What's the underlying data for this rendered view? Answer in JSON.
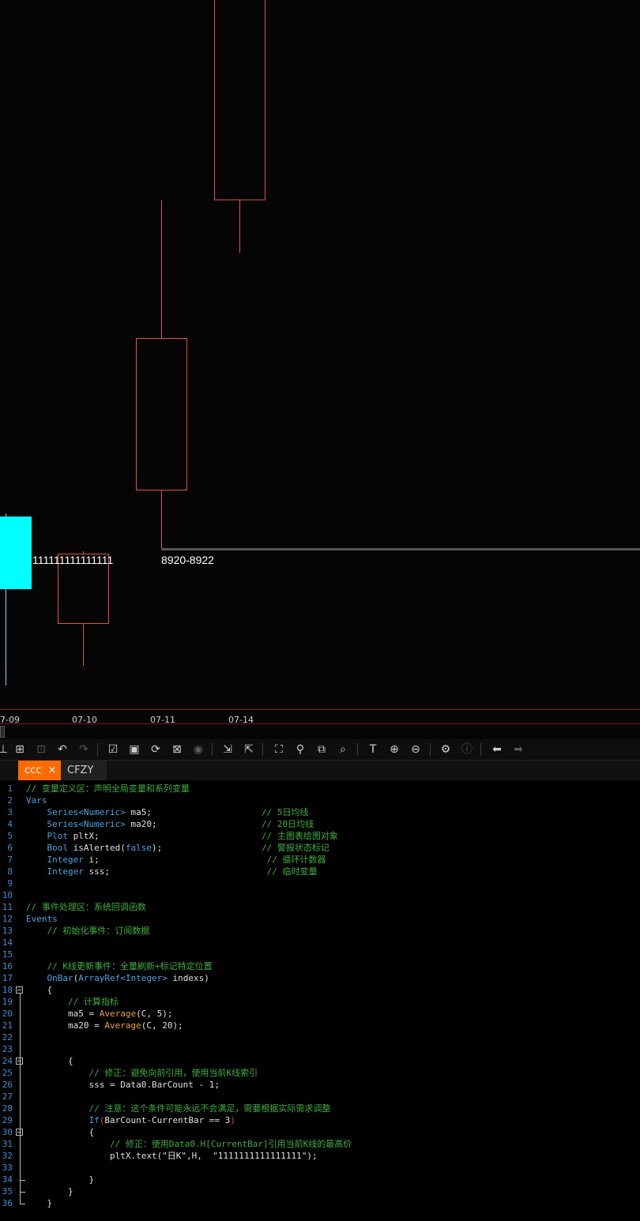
{
  "chart": {
    "annotations": {
      "marker_text": "111111111111111",
      "price_range": "8920-8922"
    },
    "date_labels": [
      "7-09",
      "07-10",
      "07-11",
      "07-14"
    ],
    "colors": {
      "candle_outline": "#e05050",
      "marker_box": "#00ffff",
      "background": "#050505",
      "axis_border": "#8a0f14",
      "price_line": "#555555"
    }
  },
  "toolbar": {
    "icons": [
      "add-icon",
      "new-file-icon",
      "template-icon",
      "undo-icon",
      "redo-icon",
      "check-icon",
      "save-icon",
      "refresh-icon",
      "compile-icon",
      "stop-icon",
      "import-icon",
      "export-icon",
      "fullscreen-icon",
      "search-icon",
      "copy-icon",
      "find-replace-icon",
      "text-icon",
      "zoom-in-icon",
      "zoom-out-icon",
      "settings-icon",
      "info-icon",
      "back-arrow-icon",
      "forward-arrow-icon"
    ]
  },
  "tabs": [
    {
      "label": "ccc",
      "close": "×"
    },
    {
      "label": "CFZY"
    }
  ],
  "editor": {
    "lines": [
      {
        "n": "1",
        "parts": [
          [
            "c-com",
            "// 变量定义区：声明全局变量和系列变量"
          ]
        ]
      },
      {
        "n": "2",
        "parts": [
          [
            "c-kw",
            "Vars"
          ]
        ]
      },
      {
        "n": "3",
        "parts": [
          [
            "c-txt",
            "    "
          ],
          [
            "c-kw",
            "Series<Numeric>"
          ],
          [
            "c-txt",
            " ma5;                     "
          ],
          [
            "c-com",
            "// 5日均线"
          ]
        ]
      },
      {
        "n": "4",
        "parts": [
          [
            "c-txt",
            "    "
          ],
          [
            "c-kw",
            "Series<Numeric>"
          ],
          [
            "c-txt",
            " ma20;                    "
          ],
          [
            "c-com",
            "// 20日均线"
          ]
        ]
      },
      {
        "n": "5",
        "parts": [
          [
            "c-txt",
            "    "
          ],
          [
            "c-kw",
            "Plot"
          ],
          [
            "c-txt",
            " pltX;                               "
          ],
          [
            "c-com",
            "// 主图表绘图对象"
          ]
        ]
      },
      {
        "n": "6",
        "parts": [
          [
            "c-txt",
            "    "
          ],
          [
            "c-kw",
            "Bool"
          ],
          [
            "c-txt",
            " isAlerted("
          ],
          [
            "c-kw",
            "false"
          ],
          [
            "c-txt",
            ");                   "
          ],
          [
            "c-com",
            "// 警报状态标记"
          ]
        ]
      },
      {
        "n": "7",
        "parts": [
          [
            "c-txt",
            "    "
          ],
          [
            "c-kw",
            "Integer"
          ],
          [
            "c-txt",
            " i;                                "
          ],
          [
            "c-com",
            "// 循环计数器"
          ]
        ]
      },
      {
        "n": "8",
        "parts": [
          [
            "c-txt",
            "    "
          ],
          [
            "c-kw",
            "Integer"
          ],
          [
            "c-txt",
            " sss;                              "
          ],
          [
            "c-com",
            "// 临时变量"
          ]
        ]
      },
      {
        "n": "9",
        "parts": []
      },
      {
        "n": "10",
        "parts": []
      },
      {
        "n": "11",
        "parts": [
          [
            "c-com",
            "// 事件处理区：系统回调函数"
          ]
        ]
      },
      {
        "n": "12",
        "parts": [
          [
            "c-kw",
            "Events"
          ]
        ]
      },
      {
        "n": "13",
        "parts": [
          [
            "c-txt",
            "    "
          ],
          [
            "c-com",
            "// 初始化事件：订阅数据"
          ]
        ]
      },
      {
        "n": "14",
        "parts": []
      },
      {
        "n": "15",
        "parts": []
      },
      {
        "n": "16",
        "parts": [
          [
            "c-txt",
            "    "
          ],
          [
            "c-com",
            "// K线更新事件：全量刷新+标记特定位置"
          ]
        ]
      },
      {
        "n": "17",
        "parts": [
          [
            "c-txt",
            "    "
          ],
          [
            "c-kw",
            "OnBar"
          ],
          [
            "c-txt",
            "("
          ],
          [
            "c-kw",
            "ArrayRef<Integer>"
          ],
          [
            "c-txt",
            " indexs)"
          ]
        ]
      },
      {
        "n": "18",
        "parts": [
          [
            "c-txt",
            "    {"
          ]
        ]
      },
      {
        "n": "19",
        "parts": [
          [
            "c-txt",
            "        "
          ],
          [
            "c-com",
            "// 计算指标"
          ]
        ]
      },
      {
        "n": "20",
        "parts": [
          [
            "c-txt",
            "        ma5 = "
          ],
          [
            "c-fn",
            "Average"
          ],
          [
            "c-txt",
            "(C, 5);"
          ]
        ]
      },
      {
        "n": "21",
        "parts": [
          [
            "c-txt",
            "        ma20 = "
          ],
          [
            "c-fn",
            "Average"
          ],
          [
            "c-txt",
            "(C, 20);"
          ]
        ]
      },
      {
        "n": "22",
        "parts": []
      },
      {
        "n": "23",
        "parts": []
      },
      {
        "n": "24",
        "parts": [
          [
            "c-txt",
            "        {"
          ]
        ]
      },
      {
        "n": "25",
        "parts": [
          [
            "c-txt",
            "            "
          ],
          [
            "c-com",
            "// 修正：避免向前引用，使用当前K线索引"
          ]
        ]
      },
      {
        "n": "26",
        "parts": [
          [
            "c-txt",
            "            sss = Data0.BarCount - 1;"
          ]
        ]
      },
      {
        "n": "27",
        "parts": []
      },
      {
        "n": "28",
        "parts": [
          [
            "c-txt",
            "            "
          ],
          [
            "c-com",
            "// 注意：这个条件可能永远不会满足，需要根据实际需求调整"
          ]
        ]
      },
      {
        "n": "29",
        "parts": [
          [
            "c-txt",
            "            "
          ],
          [
            "c-kw",
            "If"
          ],
          [
            "c-red",
            "("
          ],
          [
            "c-txt",
            "BarCount-CurrentBar == 3"
          ],
          [
            "c-red",
            ")"
          ]
        ]
      },
      {
        "n": "30",
        "parts": [
          [
            "c-txt",
            "            {"
          ]
        ]
      },
      {
        "n": "31",
        "parts": [
          [
            "c-txt",
            "                "
          ],
          [
            "c-com",
            "// 修正：使用Data0.H[CurrentBar]引用当前K线的最高价"
          ]
        ]
      },
      {
        "n": "32",
        "parts": [
          [
            "c-txt",
            "                pltX.text(\"日K\",H,  \"1111111111111111\");"
          ]
        ]
      },
      {
        "n": "33",
        "parts": []
      },
      {
        "n": "34",
        "parts": [
          [
            "c-txt",
            "            }"
          ]
        ]
      },
      {
        "n": "35",
        "parts": [
          [
            "c-txt",
            "        }"
          ]
        ]
      },
      {
        "n": "36",
        "parts": [
          [
            "c-txt",
            "    }"
          ]
        ]
      }
    ]
  }
}
